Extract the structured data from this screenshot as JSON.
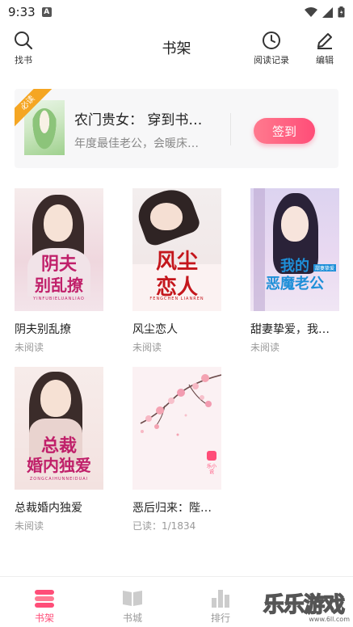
{
  "status_bar": {
    "time": "9:33",
    "notification_badge": "A"
  },
  "header": {
    "title": "书架",
    "search_label": "找书",
    "history_label": "阅读记录",
    "edit_label": "编辑"
  },
  "promo": {
    "ribbon": "必读",
    "title": "农门贵女： 穿到书…",
    "subtitle": "年度最佳老公，会暖床…",
    "checkin_label": "签到"
  },
  "books": [
    {
      "title": "阴夫别乱撩",
      "status": "未阅读",
      "cover_title_1": "阴夫",
      "cover_title_2": "别乱撩",
      "cover_pinyin": "YINFUBIELUANLIAO"
    },
    {
      "title": "风尘恋人",
      "status": "未阅读",
      "cover_title_1": "风尘",
      "cover_title_2": "恋人",
      "cover_pinyin": "FENGCHEN LIANREN"
    },
    {
      "title": "甜妻挚爱，我…",
      "status": "未阅读",
      "cover_title_1": "我的",
      "cover_title_2": "恶魔老公",
      "cover_tag": "甜妻挚爱"
    },
    {
      "title": "总裁婚内独爱",
      "status": "未阅读",
      "cover_title_1": "总裁",
      "cover_title_2": "婚内独爱",
      "cover_pinyin": "ZONGCAIHUNNEIDUAI"
    },
    {
      "title": "恶后归来：陛…",
      "status": "已读：1/1834",
      "cover_brand": "乐小说"
    }
  ],
  "tabs": [
    {
      "label": "书架",
      "active": true
    },
    {
      "label": "书城",
      "active": false
    },
    {
      "label": "排行",
      "active": false
    }
  ],
  "watermark": {
    "text": "乐乐游戏",
    "url": "www.6ll.com"
  },
  "colors": {
    "accent": "#ff4d78",
    "text_primary": "#222222",
    "text_secondary": "#999999",
    "card_bg": "#f7f7f8"
  }
}
